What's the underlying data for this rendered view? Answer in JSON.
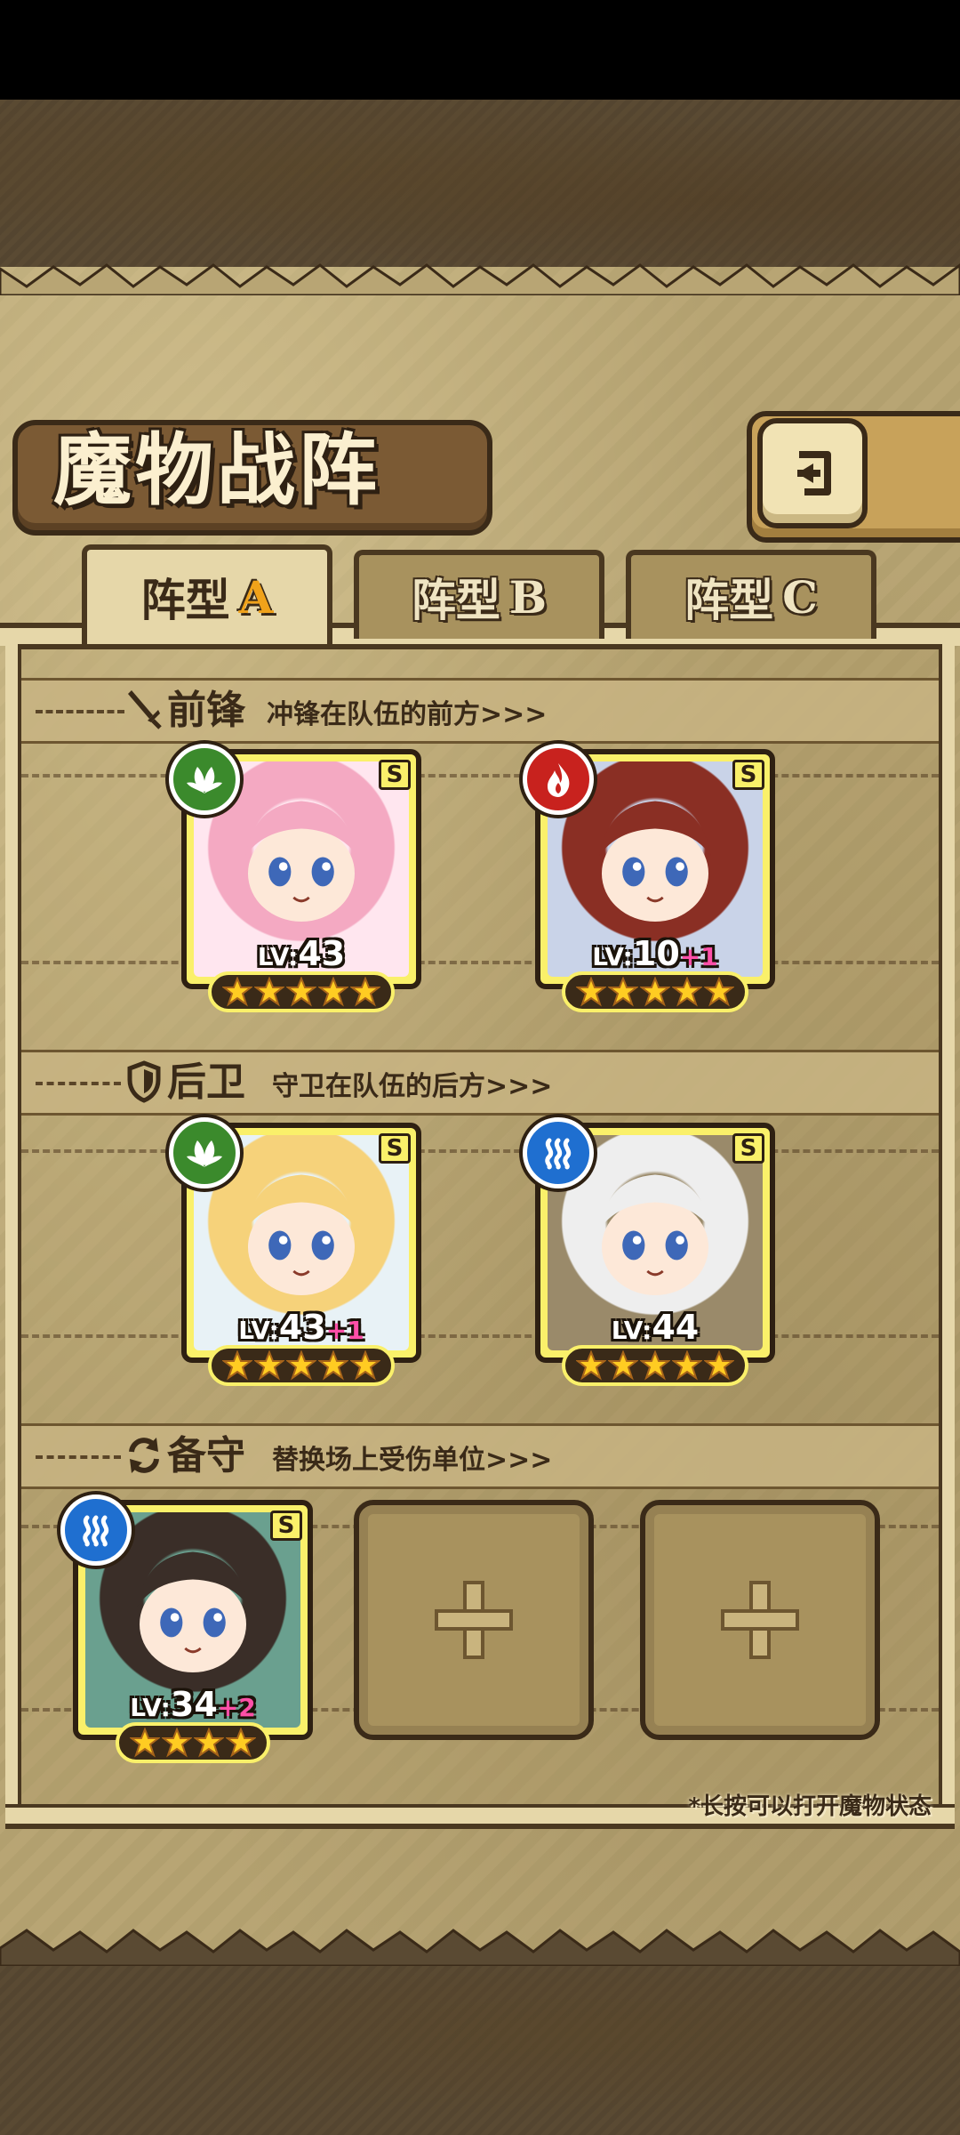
{
  "header": {
    "title": "魔物战阵",
    "back_icon": "return-arrow-icon"
  },
  "tabs": [
    {
      "prefix": "阵型",
      "suffix": "A",
      "active": true
    },
    {
      "prefix": "阵型",
      "suffix": "B",
      "active": false
    },
    {
      "prefix": "阵型",
      "suffix": "C",
      "active": false
    }
  ],
  "sections": {
    "front": {
      "title": "前锋",
      "desc": "冲锋在队伍的前方>>>",
      "icon": "sword-icon"
    },
    "rear": {
      "title": "后卫",
      "desc": "守卫在队伍的后方>>>",
      "icon": "shield-icon"
    },
    "reserve": {
      "title": "备守",
      "desc": "替换场上受伤单位>>>",
      "icon": "swap-icon"
    }
  },
  "front_units": [
    {
      "element": "nature",
      "rank": "S",
      "level_prefix": "LV:",
      "level": "43",
      "bonus": "",
      "stars": 5,
      "colors": [
        "#f4a9c2",
        "#ffe6ef"
      ]
    },
    {
      "element": "fire",
      "rank": "S",
      "level_prefix": "LV:",
      "level": "10",
      "bonus": "+1",
      "stars": 5,
      "colors": [
        "#8a2f24",
        "#c9d3e8"
      ]
    }
  ],
  "rear_units": [
    {
      "element": "nature",
      "rank": "S",
      "level_prefix": "LV:",
      "level": "43",
      "bonus": "+1",
      "stars": 5,
      "colors": [
        "#f6d27a",
        "#e8f2f6"
      ]
    },
    {
      "element": "water",
      "rank": "S",
      "level_prefix": "LV:",
      "level": "44",
      "bonus": "",
      "stars": 5,
      "colors": [
        "#eeeeee",
        "#9a8a6a"
      ]
    }
  ],
  "reserve_units": [
    {
      "element": "water",
      "rank": "S",
      "level_prefix": "LV:",
      "level": "34",
      "bonus": "+2",
      "stars": 4,
      "colors": [
        "#3a2e28",
        "#6aa08f"
      ]
    }
  ],
  "reserve_empty_slots": 2,
  "hint": "*长按可以打开魔物状态",
  "colors": {
    "card_border": "#faf06a",
    "nature": "#3b8a2c",
    "fire": "#c8221e",
    "water": "#1f6fd0",
    "bonus": "#ff4fa8",
    "accent_tab": "#f0a21a"
  }
}
